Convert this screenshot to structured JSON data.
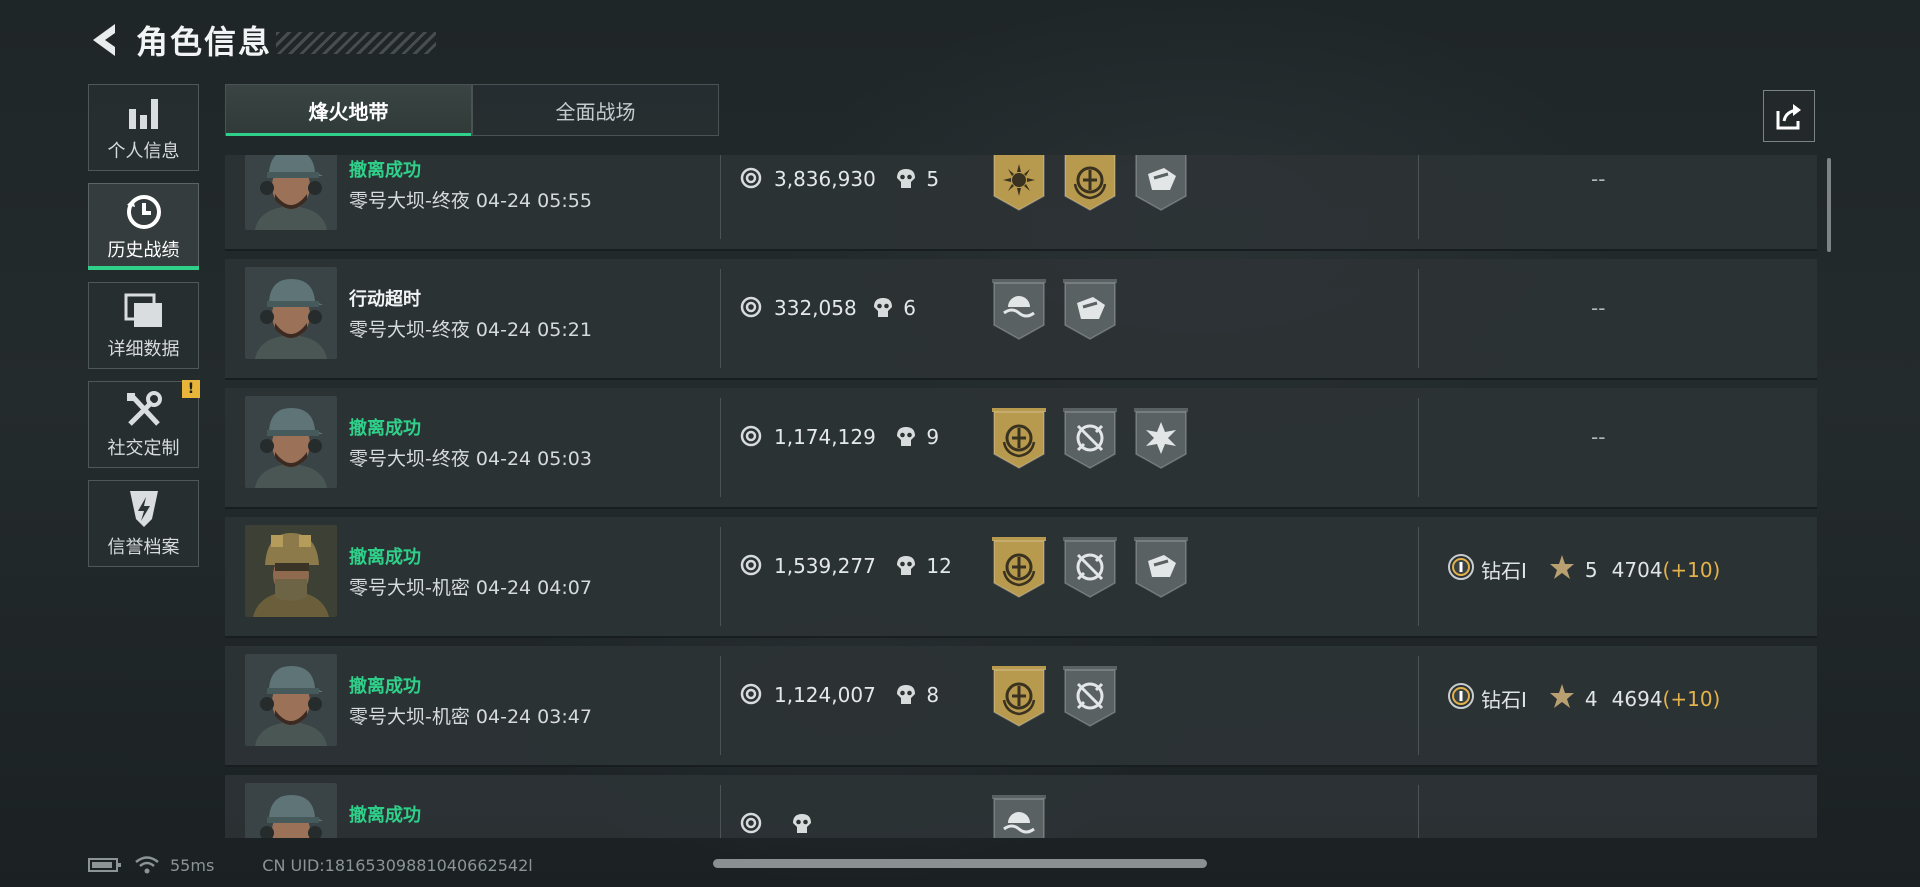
{
  "header": {
    "title": "角色信息"
  },
  "sidebar": {
    "items": [
      {
        "label": "个人信息",
        "icon": "bar-chart-icon",
        "active": false
      },
      {
        "label": "历史战绩",
        "icon": "history-clock-icon",
        "active": true
      },
      {
        "label": "详细数据",
        "icon": "folder-stack-icon",
        "active": false
      },
      {
        "label": "社交定制",
        "icon": "tools-icon",
        "active": false,
        "badge": "!"
      },
      {
        "label": "信誉档案",
        "icon": "shield-bolt-icon",
        "active": false
      }
    ]
  },
  "tabs": [
    {
      "label": "烽火地带",
      "active": true
    },
    {
      "label": "全面战场",
      "active": false
    }
  ],
  "colors": {
    "success": "#2fd08a",
    "accent_gold": "#e3b24a",
    "badge_gold": "#b89a4e",
    "badge_gray": "#5a6163"
  },
  "records": [
    {
      "outcome": "撤离成功",
      "outcome_type": "success",
      "map": "零号大坝-终夜",
      "time": "04-24 05:55",
      "value": "3,836,930",
      "kills": "5",
      "badges": [
        "gold-sun-badge-icon",
        "gold-emblem-badge-icon",
        "gray-crate-badge-icon"
      ],
      "rank": "--",
      "avatar": "cap-operator"
    },
    {
      "outcome": "行动超时",
      "outcome_type": "timeout",
      "map": "零号大坝-终夜",
      "time": "04-24 05:21",
      "value": "332,058",
      "kills": "6",
      "badges": [
        "gray-wave-badge-icon",
        "gray-crate-badge-icon"
      ],
      "rank": "--",
      "avatar": "cap-operator"
    },
    {
      "outcome": "撤离成功",
      "outcome_type": "success",
      "map": "零号大坝-终夜",
      "time": "04-24 05:03",
      "value": "1,174,129",
      "kills": "9",
      "badges": [
        "gold-emblem-badge-icon",
        "gray-crosshair-badge-icon",
        "gray-burst-badge-icon"
      ],
      "rank": "--",
      "avatar": "cap-operator"
    },
    {
      "outcome": "撤离成功",
      "outcome_type": "success",
      "map": "零号大坝-机密",
      "time": "04-24 04:07",
      "value": "1,539,277",
      "kills": "12",
      "badges": [
        "gold-emblem-badge-icon",
        "gray-crosshair-badge-icon",
        "gray-crate-badge-icon"
      ],
      "rank": {
        "name": "钻石I",
        "level": "5",
        "points": "4704",
        "delta": "(+10)"
      },
      "avatar": "helmet-operator"
    },
    {
      "outcome": "撤离成功",
      "outcome_type": "success",
      "map": "零号大坝-机密",
      "time": "04-24 03:47",
      "value": "1,124,007",
      "kills": "8",
      "badges": [
        "gold-emblem-badge-icon",
        "gray-crosshair-badge-icon"
      ],
      "rank": {
        "name": "钻石I",
        "level": "4",
        "points": "4694",
        "delta": "(+10)"
      },
      "avatar": "cap-operator"
    },
    {
      "outcome": "撤离成功",
      "outcome_type": "success",
      "map": "",
      "time": "",
      "value": "",
      "kills": "",
      "badges": [
        "gray-wave-badge-icon"
      ],
      "rank": "",
      "avatar": "cap-operator"
    }
  ],
  "status": {
    "ping": "55ms",
    "uid": "CN UID:18165309881040662542l"
  }
}
